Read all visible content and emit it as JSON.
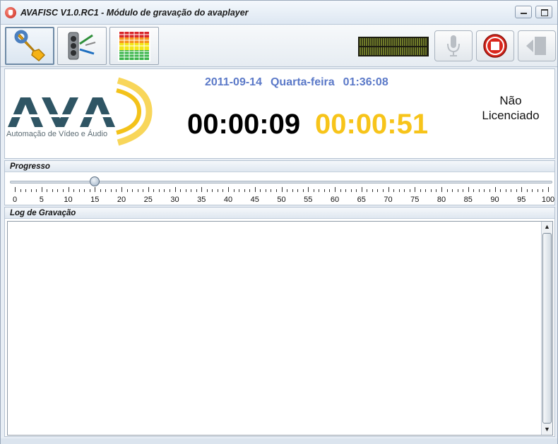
{
  "window": {
    "title": "AVAFISC V1.0.RC1 - Módulo de gravação do avaplayer"
  },
  "header": {
    "logo_text": "AVA",
    "logo_subtitle": "Automação de Vídeo e Áudio",
    "date": "2011-09-14",
    "weekday": "Quarta-feira",
    "clock": "01:36:08",
    "elapsed": "00:00:09",
    "remaining": "00:00:51",
    "license_line1": "Não",
    "license_line2": "Licenciado"
  },
  "progress": {
    "title": "Progresso",
    "value_percent": 15,
    "labels": [
      "0",
      "5",
      "10",
      "15",
      "20",
      "25",
      "30",
      "35",
      "40",
      "45",
      "50",
      "55",
      "60",
      "65",
      "70",
      "75",
      "80",
      "85",
      "90",
      "95",
      "100"
    ]
  },
  "log": {
    "title": "Log de Gravação"
  },
  "icons": {
    "toolbar": [
      "wrench-icon",
      "cable-plug-icon",
      "equalizer-icon",
      "microphone-icon",
      "stop-icon",
      "exit-door-icon"
    ]
  },
  "colors": {
    "date_blue": "#5b79c8",
    "remaining_yellow": "#f7c41a",
    "stop_red": "#d9261c"
  }
}
